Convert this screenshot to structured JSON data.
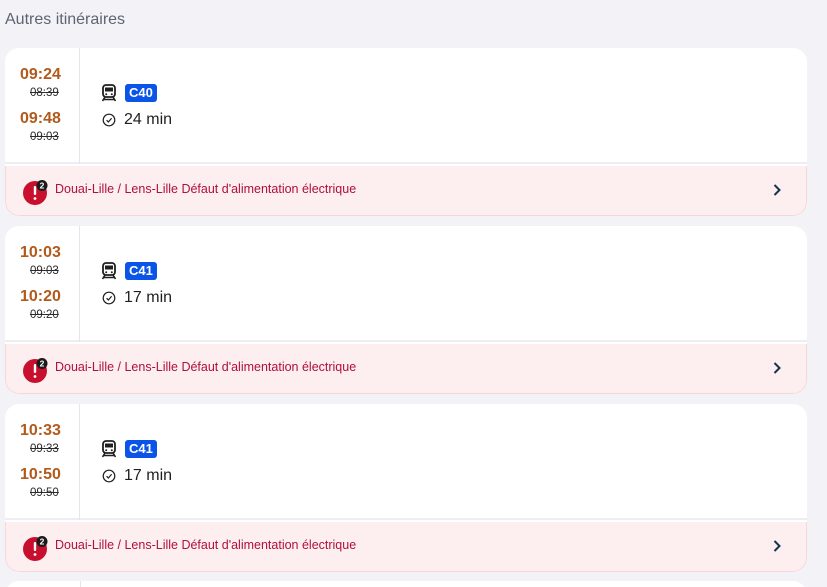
{
  "section_title": "Autres itinéraires",
  "colors": {
    "accent_time": "#b15a1c",
    "line_badge": "#0a54e8",
    "alert_text": "#b0103a",
    "alert_bg": "#fdeef0"
  },
  "itineraries": [
    {
      "departure_actual": "09:24",
      "departure_planned": "08:39",
      "arrival_actual": "09:48",
      "arrival_planned": "09:03",
      "mode_icon": "train-icon",
      "line": "C40",
      "duration": "24 min",
      "alert": {
        "count": "2",
        "text": "Douai-Lille / Lens-Lille Défaut d'alimentation électrique"
      }
    },
    {
      "departure_actual": "10:03",
      "departure_planned": "09:03",
      "arrival_actual": "10:20",
      "arrival_planned": "09:20",
      "mode_icon": "train-icon",
      "line": "C41",
      "duration": "17 min",
      "alert": {
        "count": "2",
        "text": "Douai-Lille / Lens-Lille Défaut d'alimentation électrique"
      }
    },
    {
      "departure_actual": "10:33",
      "departure_planned": "09:33",
      "arrival_actual": "10:50",
      "arrival_planned": "09:50",
      "mode_icon": "train-icon",
      "line": "C41",
      "duration": "17 min",
      "alert": {
        "count": "2",
        "text": "Douai-Lille / Lens-Lille Défaut d'alimentation électrique"
      }
    }
  ]
}
